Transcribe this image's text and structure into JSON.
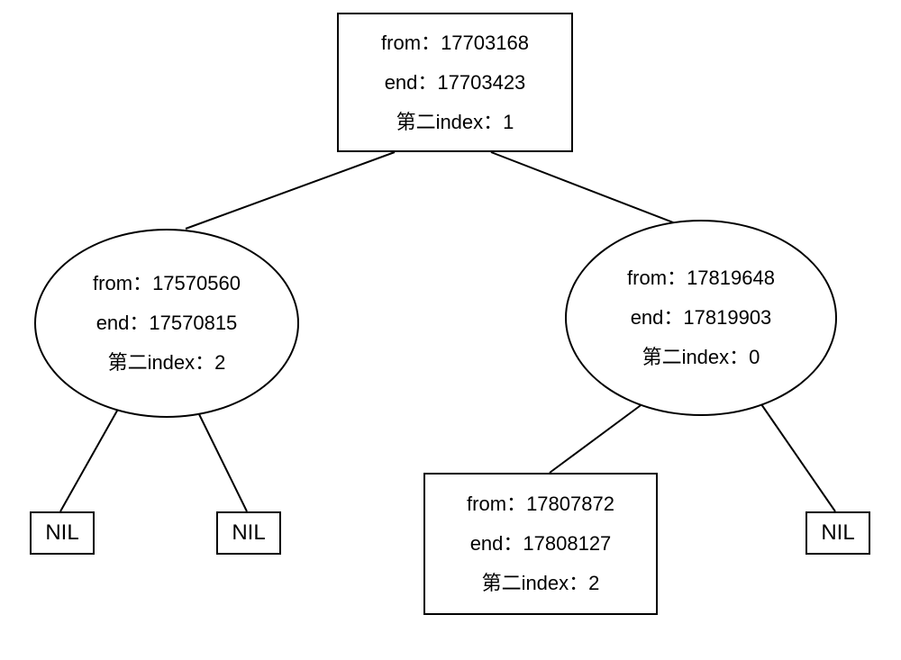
{
  "labels": {
    "from": "from：",
    "end": "end：",
    "index": "第二index：",
    "nil": "NIL"
  },
  "nodes": {
    "root": {
      "from": "17703168",
      "end": "17703423",
      "index": "1"
    },
    "left": {
      "from": "17570560",
      "end": "17570815",
      "index": "2"
    },
    "right": {
      "from": "17819648",
      "end": "17819903",
      "index": "0"
    },
    "inner": {
      "from": "17807872",
      "end": "17808127",
      "index": "2"
    }
  }
}
